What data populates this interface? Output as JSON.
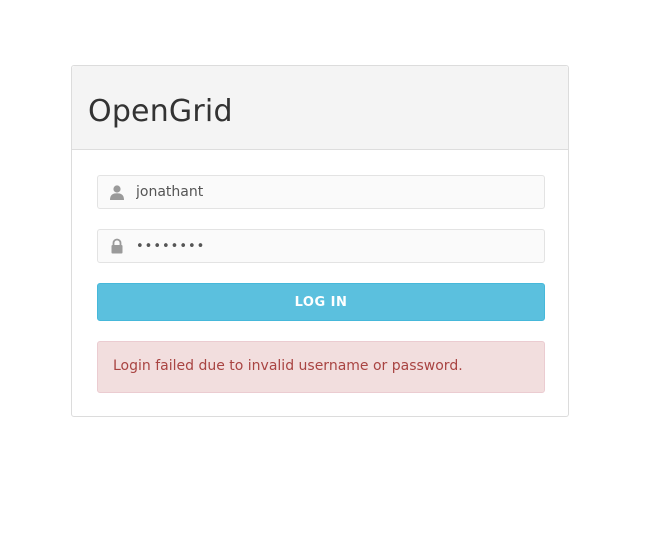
{
  "app": {
    "title": "OpenGrid"
  },
  "login_form": {
    "username": {
      "value": "jonathant",
      "icon": "user-icon"
    },
    "password": {
      "value": "password",
      "icon": "lock-icon"
    },
    "submit_label": "LOG IN"
  },
  "alert": {
    "message": "Login failed due to invalid username or password.",
    "type": "danger"
  },
  "colors": {
    "button_bg": "#5bc0de",
    "alert_bg": "#f2dede",
    "alert_text": "#a94442",
    "header_bg": "#f4f4f4"
  }
}
